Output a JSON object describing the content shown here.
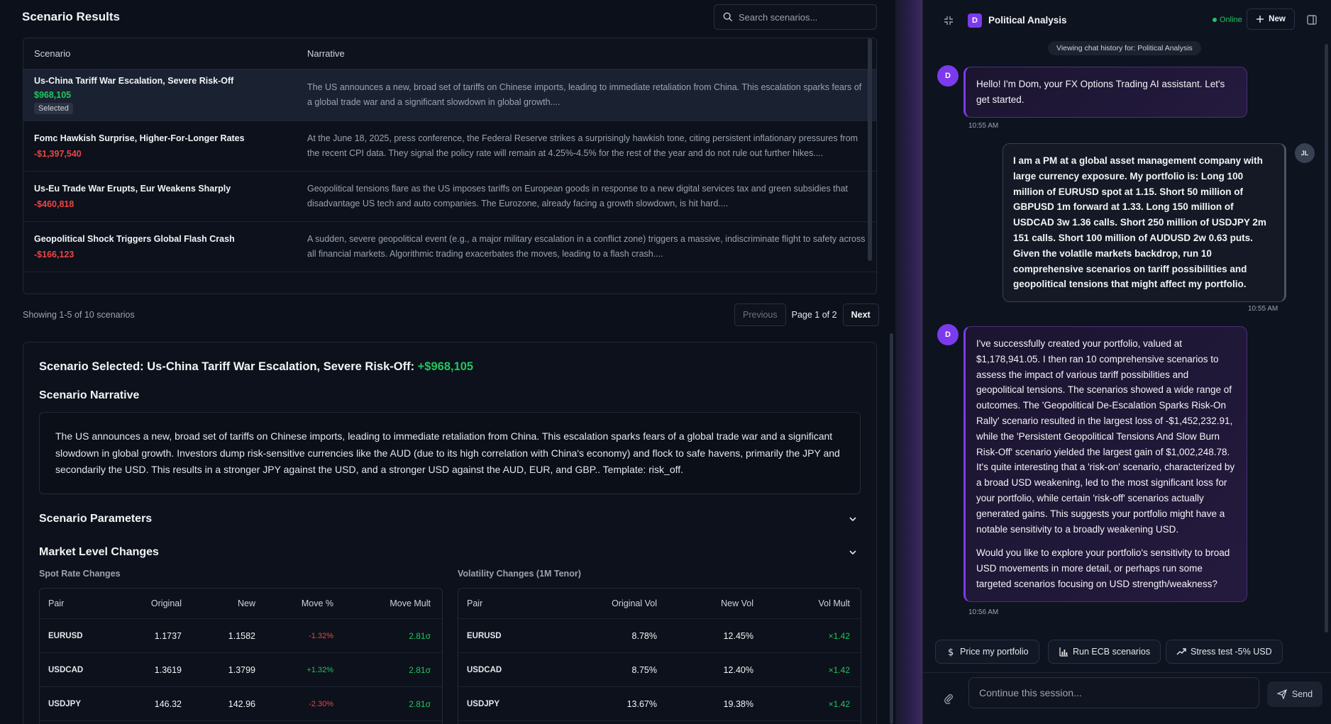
{
  "left": {
    "title": "Scenario Results",
    "search_placeholder": "Search scenarios...",
    "table": {
      "col_scenario": "Scenario",
      "col_narrative": "Narrative",
      "rows": [
        {
          "name": "Us-China Tariff War Escalation, Severe Risk-Off",
          "value": "$968,105",
          "badge": "Selected",
          "narrative": "The US announces a new, broad set of tariffs on Chinese imports, leading to immediate retaliation from China. This escalation sparks fears of a global trade war and a significant slowdown in global growth...."
        },
        {
          "name": "Fomc Hawkish Surprise, Higher-For-Longer Rates",
          "value": "-$1,397,540",
          "narrative": "At the June 18, 2025, press conference, the Federal Reserve strikes a surprisingly hawkish tone, citing persistent inflationary pressures from the recent CPI data. They signal the policy rate will remain at 4.25%-4.5% for the rest of the year and do not rule out further hikes...."
        },
        {
          "name": "Us-Eu Trade War Erupts, Eur Weakens Sharply",
          "value": "-$460,818",
          "narrative": "Geopolitical tensions flare as the US imposes tariffs on European goods in response to a new digital services tax and green subsidies that disadvantage US tech and auto companies. The Eurozone, already facing a growth slowdown, is hit hard...."
        },
        {
          "name": "Geopolitical Shock Triggers Global Flash Crash",
          "value": "-$166,123",
          "narrative": "A sudden, severe geopolitical event (e.g., a major military escalation in a conflict zone) triggers a massive, indiscriminate flight to safety across all financial markets. Algorithmic trading exacerbates the moves, leading to a flash crash...."
        }
      ]
    },
    "showing": "Showing 1-5 of 10 scenarios",
    "pager": {
      "prev": "Previous",
      "page": "Page 1 of 2",
      "next": "Next"
    },
    "detail": {
      "selected_prefix": "Scenario Selected: Us-China Tariff War Escalation, Severe Risk-Off: ",
      "selected_value": "+$968,105",
      "narrative_heading": "Scenario Narrative",
      "narrative_text": "The US announces a new, broad set of tariffs on Chinese imports, leading to immediate retaliation from China. This escalation sparks fears of a global trade war and a significant slowdown in global growth. Investors dump risk-sensitive currencies like the AUD (due to its high correlation with China's economy) and flock to safe havens, primarily the JPY and secondarily the USD. This results in a stronger JPY against the USD, and a stronger USD against the AUD, EUR, and GBP.. Template: risk_off.",
      "params_heading": "Scenario Parameters",
      "market_heading": "Market Level Changes",
      "spot_heading": "Spot Rate Changes",
      "vol_heading": "Volatility Changes (1M Tenor)",
      "spot_cols": [
        "Pair",
        "Original",
        "New",
        "Move %",
        "Move Mult"
      ],
      "spot_rows": [
        [
          "EURUSD",
          "1.1737",
          "1.1582",
          "-1.32%",
          "2.81σ"
        ],
        [
          "USDCAD",
          "1.3619",
          "1.3799",
          "+1.32%",
          "2.81σ"
        ],
        [
          "USDJPY",
          "146.32",
          "142.96",
          "-2.30%",
          "2.81σ"
        ]
      ],
      "vol_cols": [
        "Pair",
        "Original Vol",
        "New Vol",
        "Vol Mult"
      ],
      "vol_rows": [
        [
          "EURUSD",
          "8.78%",
          "12.45%",
          "×1.42"
        ],
        [
          "USDCAD",
          "8.75%",
          "12.40%",
          "×1.42"
        ],
        [
          "USDJPY",
          "13.67%",
          "19.38%",
          "×1.42"
        ]
      ]
    }
  },
  "chat": {
    "header_avatar": "D",
    "title": "Political Analysis",
    "status": "Online",
    "new_label": "New",
    "history_pill": "Viewing chat history for: Political Analysis",
    "messages": [
      {
        "role": "assistant",
        "avatar": "D",
        "text": "Hello! I'm Dom, your FX Options Trading AI assistant. Let's get started.",
        "time": "10:55 AM"
      },
      {
        "role": "user",
        "avatar": "JL",
        "text": "I am a PM at a global asset management company with large currency exposure. My portfolio is: Long 100 million of EURUSD spot at 1.15. Short 50 million of GBPUSD 1m forward at 1.33. Long 150 million of USDCAD 3w 1.36 calls. Short 250 million of USDJPY 2m 151 calls. Short 100 million of AUDUSD 2w 0.63 puts. Given the volatile markets backdrop, run 10 comprehensive scenarios on tariff possibilities and geopolitical tensions that might affect my portfolio.",
        "time": "10:55 AM"
      },
      {
        "role": "assistant",
        "avatar": "D",
        "text": "I've successfully created your portfolio, valued at $1,178,941.05. I then ran 10 comprehensive scenarios to assess the impact of various tariff possibilities and geopolitical tensions. The scenarios showed a wide range of outcomes. The 'Geopolitical De-Escalation Sparks Risk-On Rally' scenario resulted in the largest loss of -$1,452,232.91, while the 'Persistent Geopolitical Tensions And Slow Burn Risk-Off' scenario yielded the largest gain of $1,002,248.78. It's quite interesting that a 'risk-on' scenario, characterized by a broad USD weakening, led to the most significant loss for your portfolio, while certain 'risk-off' scenarios actually generated gains. This suggests your portfolio might have a notable sensitivity to a broadly weakening USD.",
        "text2": "Would you like to explore your portfolio's sensitivity to broad USD movements in more detail, or perhaps run some targeted scenarios focusing on USD strength/weakness?",
        "time": "10:56 AM"
      }
    ],
    "chips": [
      "Price my portfolio",
      "Run ECB scenarios",
      "Stress test -5% USD"
    ],
    "input_placeholder": "Continue this session...",
    "send_label": "Send"
  },
  "colors": {
    "accent": "#7c3aed",
    "positive": "#22c55e",
    "negative": "#ef4444"
  }
}
